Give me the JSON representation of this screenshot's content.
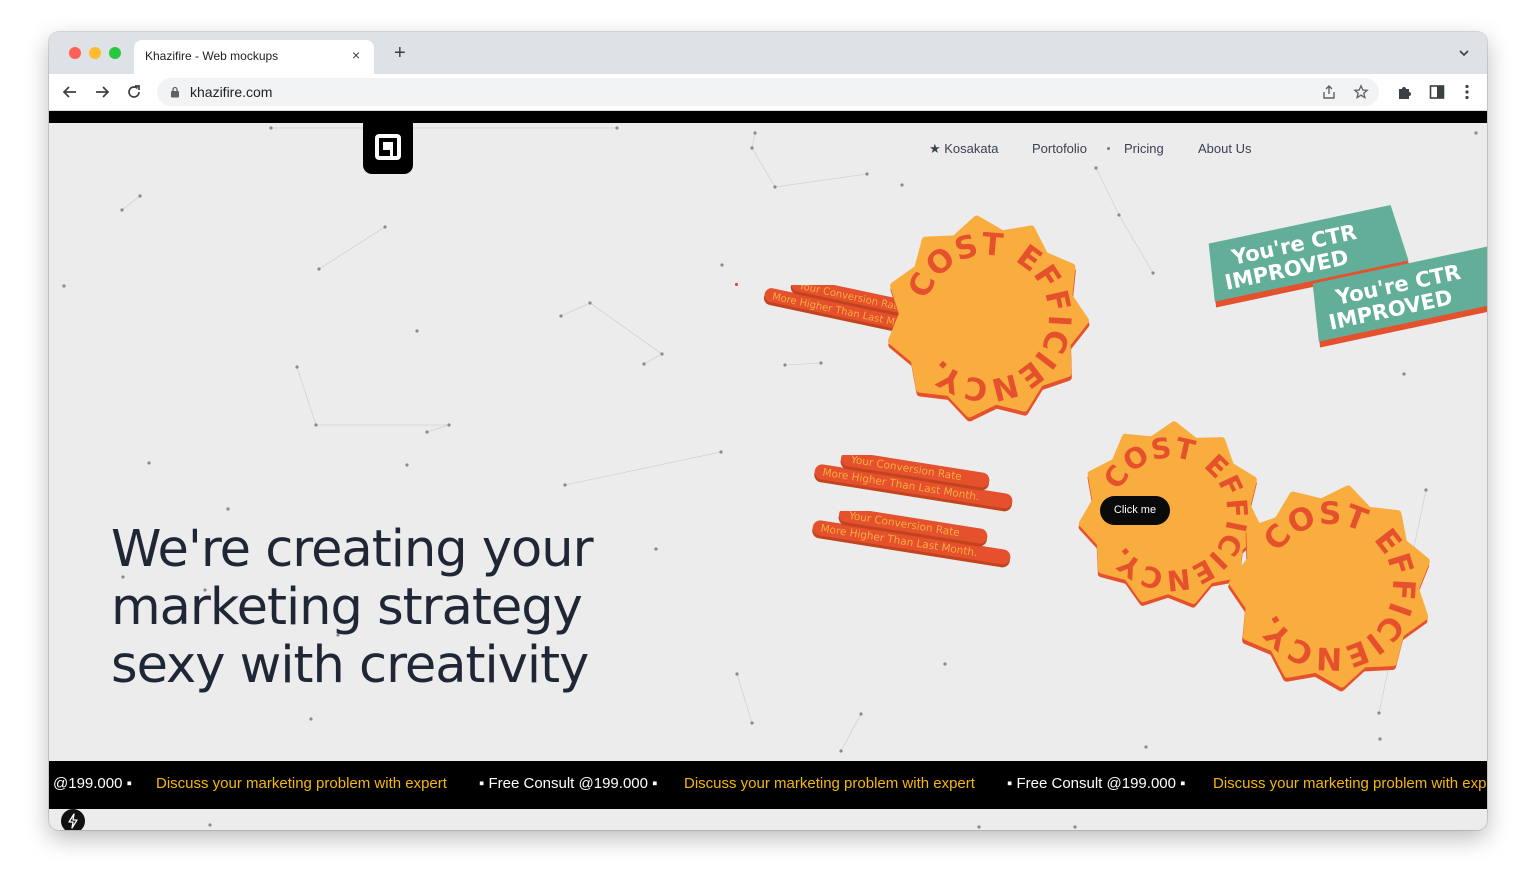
{
  "browser": {
    "tab_title": "Khazifire - Web mockups",
    "tab_close": "×",
    "new_tab": "+",
    "url": "khazifire.com"
  },
  "nav": {
    "links": [
      "★ Kosakata",
      "Portofolio",
      "Pricing",
      "About Us"
    ]
  },
  "hero": {
    "lines": [
      "We're creating your",
      "marketing strategy",
      "sexy with creativity"
    ]
  },
  "badges": {
    "arc_text": "COST EFFICIENCY.",
    "ribbon_line1": "Your Conversion Rate",
    "ribbon_line2": "More Higher Than Last Month.",
    "ctr_line1": "You're CTR",
    "ctr_line2": "IMPROVED"
  },
  "cta": {
    "click_me": "Click me"
  },
  "marquee": {
    "items": [
      {
        "text": "@199.000 ▪",
        "color": "white"
      },
      {
        "text": "Discuss your marketing problem with expert",
        "color": "yellow"
      },
      {
        "text": "▪ Free Consult @199.000 ▪",
        "color": "white"
      },
      {
        "text": "Discuss your marketing problem with expert",
        "color": "yellow"
      },
      {
        "text": "▪ Free Consult @199.000 ▪",
        "color": "white"
      },
      {
        "text": "Discuss your marketing problem with expert",
        "color": "yellow"
      }
    ]
  },
  "colors": {
    "accent_orange": "#f9ad3e",
    "accent_red": "#e5502d",
    "accent_teal": "#62ae98",
    "marquee_yellow": "#f6b60f",
    "hero_text": "#1f2635"
  }
}
